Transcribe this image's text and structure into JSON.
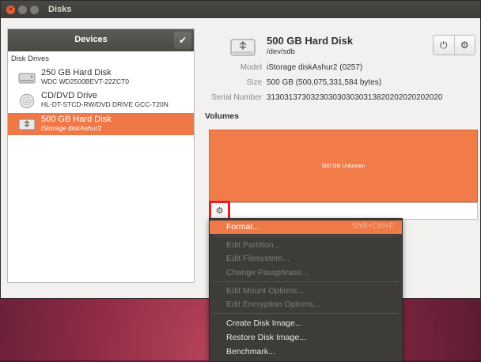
{
  "window": {
    "title": "Disks",
    "close_glyph": "×"
  },
  "devices_panel": {
    "header": "Devices",
    "check_glyph": "✔",
    "section": "Disk Drives",
    "items": [
      {
        "name": "250 GB Hard Disk",
        "subtitle": "WDC WD2500BEVT-22ZCT0",
        "icon": "hard-disk-icon"
      },
      {
        "name": "CD/DVD Drive",
        "subtitle": "HL-DT-STCD-RW/DVD DRIVE GCC-T20N",
        "icon": "optical-drive-icon"
      },
      {
        "name": "500 GB Hard Disk",
        "subtitle": "iStorage diskAshur2",
        "icon": "usb-disk-icon",
        "selected": true
      }
    ]
  },
  "disk": {
    "name": "500 GB Hard Disk",
    "path": "/dev/sdb",
    "power_glyph": "⏻",
    "gear_glyph": "⚙",
    "properties": [
      {
        "key": "Model",
        "value": "iStorage diskAshur2 (0257)"
      },
      {
        "key": "Size",
        "value": "500 GB (500,075,331,584 bytes)"
      },
      {
        "key": "Serial Number",
        "value": "3130313730323030303030313820202020202020"
      }
    ]
  },
  "volumes": {
    "label": "Volumes",
    "block_text": "500 GB Unknown",
    "gear_glyph": "⚙"
  },
  "context_menu": {
    "items": [
      {
        "label": "Format...",
        "accel": "Shift+Ctrl+F",
        "state": "highlighted"
      },
      {
        "label": "Edit Partition...",
        "state": "disabled"
      },
      {
        "label": "Edit Filesystem...",
        "state": "disabled"
      },
      {
        "label": "Change Passphrase...",
        "state": "disabled"
      },
      {
        "label": "Edit Mount Options...",
        "state": "disabled"
      },
      {
        "label": "Edit Encryption Options...",
        "state": "disabled"
      },
      {
        "label": "Create Disk Image...",
        "state": "enabled"
      },
      {
        "label": "Restore Disk Image...",
        "state": "enabled"
      },
      {
        "label": "Benchmark...",
        "state": "enabled"
      }
    ]
  },
  "colors": {
    "accent": "#f07746",
    "titlebar": "#3b3a36",
    "menu_bg": "#3d3c38",
    "highlight_box": "#e0202a"
  }
}
